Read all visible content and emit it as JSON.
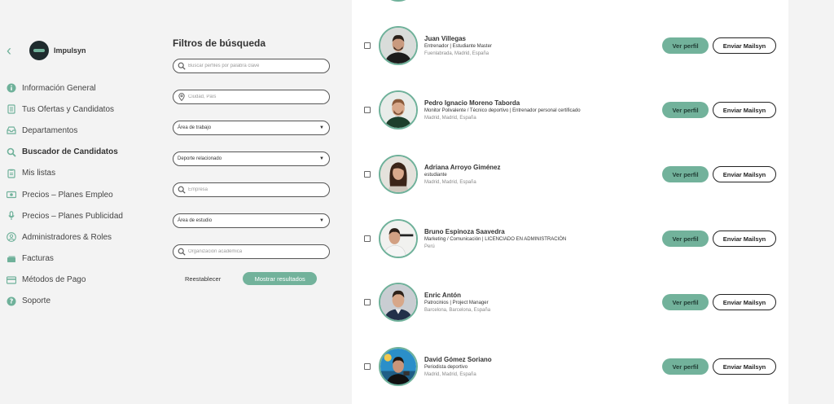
{
  "brand": {
    "name": "Impulsyn"
  },
  "sidebar": {
    "items": [
      {
        "label": "Información General",
        "icon": "info-icon"
      },
      {
        "label": "Tus Ofertas y Candidatos",
        "icon": "document-icon"
      },
      {
        "label": "Departamentos",
        "icon": "inbox-icon"
      },
      {
        "label": "Buscador de Candidatos",
        "icon": "search-icon",
        "active": true
      },
      {
        "label": "Mis listas",
        "icon": "clipboard-icon"
      },
      {
        "label": "Precios – Planes Empleo",
        "icon": "money-icon"
      },
      {
        "label": "Precios – Planes Publicidad",
        "icon": "microphone-icon"
      },
      {
        "label": "Administradores & Roles",
        "icon": "users-icon"
      },
      {
        "label": "Facturas",
        "icon": "receipt-icon"
      },
      {
        "label": "Métodos de Pago",
        "icon": "credit-card-icon"
      },
      {
        "label": "Soporte",
        "icon": "help-icon"
      }
    ]
  },
  "filters": {
    "title": "Filtros de búsqueda",
    "keyword_placeholder": "Buscar perfiles por palabra clave",
    "location_placeholder": "Ciudad, País",
    "work_area": "Área de trabajo",
    "sport": "Deporte relacionado",
    "company_placeholder": "Empresa",
    "study_area": "Área de estudio",
    "academic_org_placeholder": "Organización académica",
    "reset_label": "Reestablecer",
    "show_results_label": "Mostrar resultados"
  },
  "results": {
    "view_profile_label": "Ver perfil",
    "send_mail_label": "Enviar Mailsyn",
    "candidates": [
      {
        "name": "Juan Villegas",
        "role": "Entrenador | Estudiante Master",
        "location": "Fuenlabrada, Madrid, España"
      },
      {
        "name": "Pedro Ignacio Moreno Taborda",
        "role": "Monitor Polivalente / Técnico deportivo | Entrenador personal certificado",
        "location": "Madrid, Madrid, España"
      },
      {
        "name": "Adriana Arroyo Giménez",
        "role": "estudiante",
        "location": "Madrid, Madrid, España"
      },
      {
        "name": "Bruno Espinoza Saavedra",
        "role": "Marketing / Comunicación | LICENCIADO EN ADMINISTRACIÓN",
        "location": "Perú"
      },
      {
        "name": "Enric Antón",
        "role": "Patrocinios | Project Manager",
        "location": "Barcelona, Barcelona, España"
      },
      {
        "name": "David Gómez Soriano",
        "role": "Periodista deportivo",
        "location": "Madrid, Madrid, España"
      }
    ]
  },
  "colors": {
    "accent": "#72b29b",
    "dark": "#222222"
  }
}
